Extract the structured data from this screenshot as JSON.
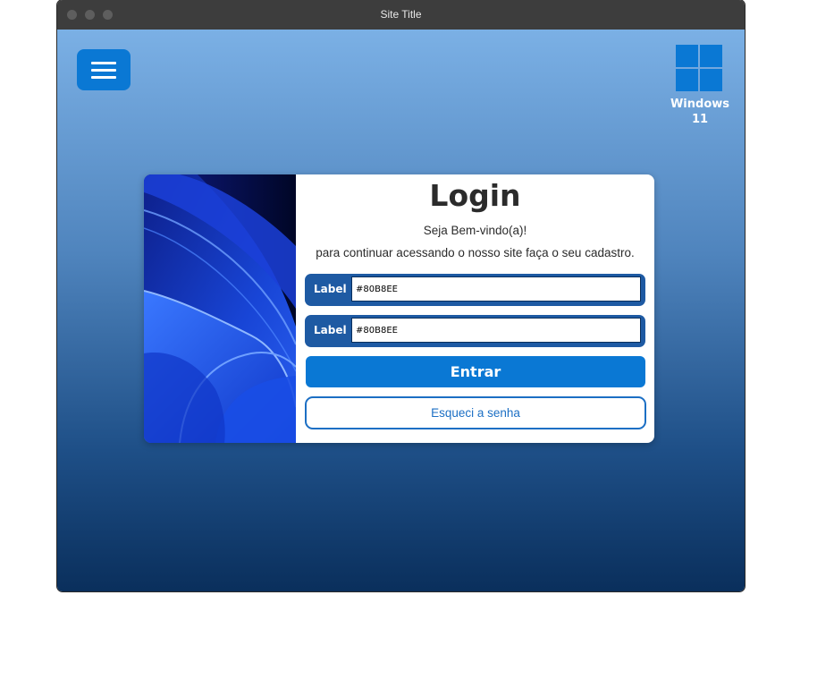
{
  "window": {
    "title": "Site Title"
  },
  "header": {
    "menu_icon": "hamburger-menu-icon",
    "os_logo_icon": "windows-logo-icon",
    "os_label": "Windows 11"
  },
  "login": {
    "title": "Login",
    "welcome": "Seja Bem-vindo(a)!",
    "subtitle": "para continuar acessando o nosso site faça o seu cadastro.",
    "fields": [
      {
        "label": "Label",
        "value": "#80B8EE"
      },
      {
        "label": "Label",
        "value": "#80B8EE"
      }
    ],
    "submit_label": "Entrar",
    "forgot_label": "Esqueci a senha"
  },
  "colors": {
    "accent": "#0A78D4",
    "field_bg": "#1E5AA3",
    "gradient_top": "#7BB0E5",
    "gradient_bottom": "#0A2F5C"
  }
}
